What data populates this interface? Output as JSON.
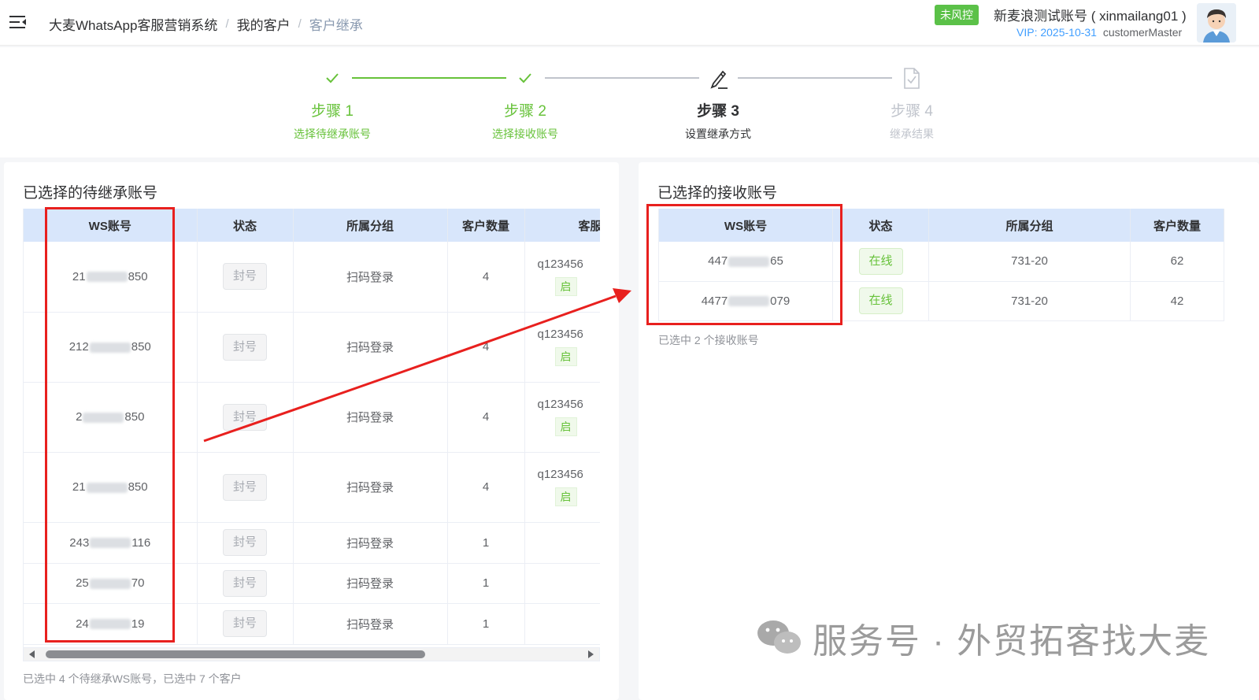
{
  "header": {
    "breadcrumb": [
      "大麦WhatsApp客服营销系统",
      "我的客户",
      "客户继承"
    ],
    "breadcrumb_sep": "/",
    "risk_badge": "未风控",
    "account_name": "新麦浪测试账号 ( xinmailang01 )",
    "vip": "VIP: 2025-10-31",
    "role": "customerMaster"
  },
  "steps": [
    {
      "title": "步骤 1",
      "desc": "选择待继承账号",
      "state": "done"
    },
    {
      "title": "步骤 2",
      "desc": "选择接收账号",
      "state": "done"
    },
    {
      "title": "步骤 3",
      "desc": "设置继承方式",
      "state": "active"
    },
    {
      "title": "步骤 4",
      "desc": "继承结果",
      "state": "wait"
    }
  ],
  "left_panel": {
    "title": "已选择的待继承账号",
    "columns": [
      "WS账号",
      "状态",
      "所属分组",
      "客户数量",
      "客服"
    ],
    "rows": [
      {
        "ws_prefix": "21",
        "ws_suffix": "850",
        "status": "封号",
        "group": "扫码登录",
        "count": "4",
        "cs_id": "q123456",
        "cs_tag": "启"
      },
      {
        "ws_prefix": "212",
        "ws_suffix": "850",
        "status": "封号",
        "group": "扫码登录",
        "count": "4",
        "cs_id": "q123456",
        "cs_tag": "启"
      },
      {
        "ws_prefix": "2",
        "ws_suffix": "850",
        "status": "封号",
        "group": "扫码登录",
        "count": "4",
        "cs_id": "q123456",
        "cs_tag": "启"
      },
      {
        "ws_prefix": "21",
        "ws_suffix": "850",
        "status": "封号",
        "group": "扫码登录",
        "count": "4",
        "cs_id": "q123456",
        "cs_tag": "启"
      },
      {
        "ws_prefix": "243",
        "ws_suffix": "116",
        "status": "封号",
        "group": "扫码登录",
        "count": "1",
        "cs_id": "",
        "cs_tag": ""
      },
      {
        "ws_prefix": "25",
        "ws_suffix": "70",
        "status": "封号",
        "group": "扫码登录",
        "count": "1",
        "cs_id": "",
        "cs_tag": ""
      },
      {
        "ws_prefix": "24",
        "ws_suffix": "19",
        "status": "封号",
        "group": "扫码登录",
        "count": "1",
        "cs_id": "",
        "cs_tag": ""
      }
    ],
    "summary": "已选中 4 个待继承WS账号，已选中 7 个客户"
  },
  "right_panel": {
    "title": "已选择的接收账号",
    "columns": [
      "WS账号",
      "状态",
      "所属分组",
      "客户数量"
    ],
    "rows": [
      {
        "ws_prefix": "447",
        "ws_suffix": "65",
        "status": "在线",
        "group": "731-20",
        "count": "62"
      },
      {
        "ws_prefix": "4477",
        "ws_suffix": "079",
        "status": "在线",
        "group": "731-20",
        "count": "42"
      }
    ],
    "summary": "已选中 2 个接收账号"
  },
  "watermark": "服务号 · 外贸拓客找大麦",
  "colors": {
    "success": "#67c23a",
    "primary": "#409eff",
    "table_header": "#d8e6fb",
    "annotation_red": "#e8201e"
  }
}
